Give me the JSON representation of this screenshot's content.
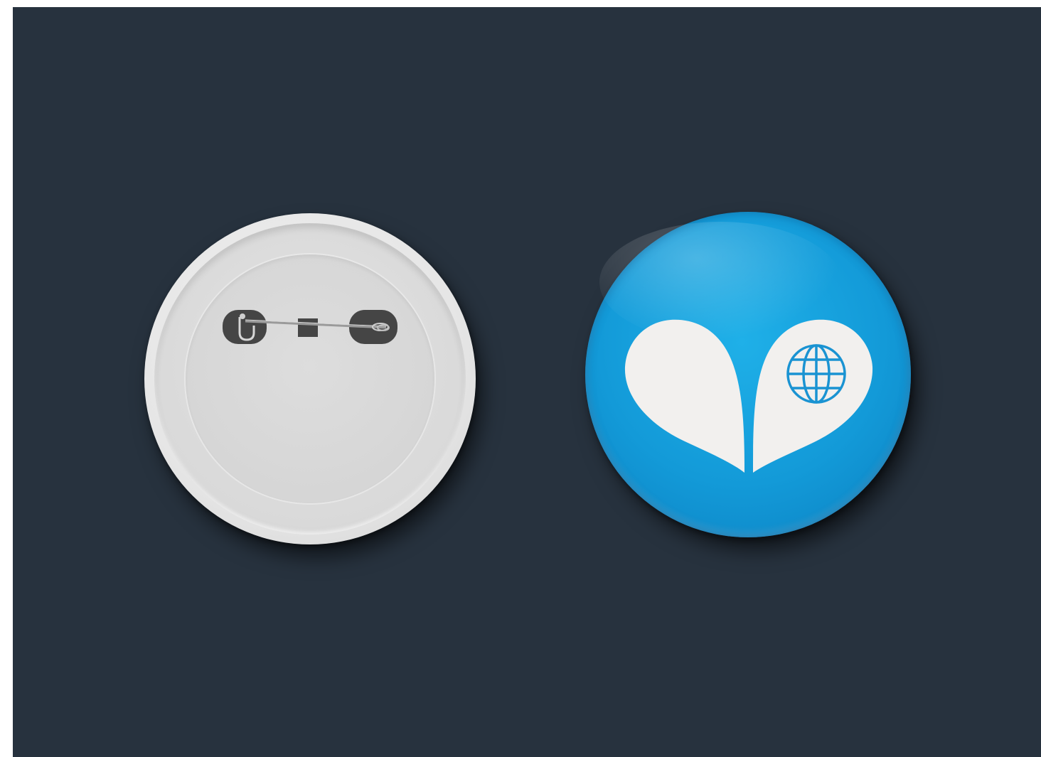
{
  "scene": {
    "background_color": "#27323e",
    "badges": [
      {
        "side": "back",
        "color": "#e0e0e0",
        "icon": "safety-pin-icon"
      },
      {
        "side": "front",
        "color": "#139ad8",
        "icon": "heart-globe-logo",
        "logo_color": "#f2f0ee",
        "globe_icon": "globe-icon"
      }
    ]
  }
}
